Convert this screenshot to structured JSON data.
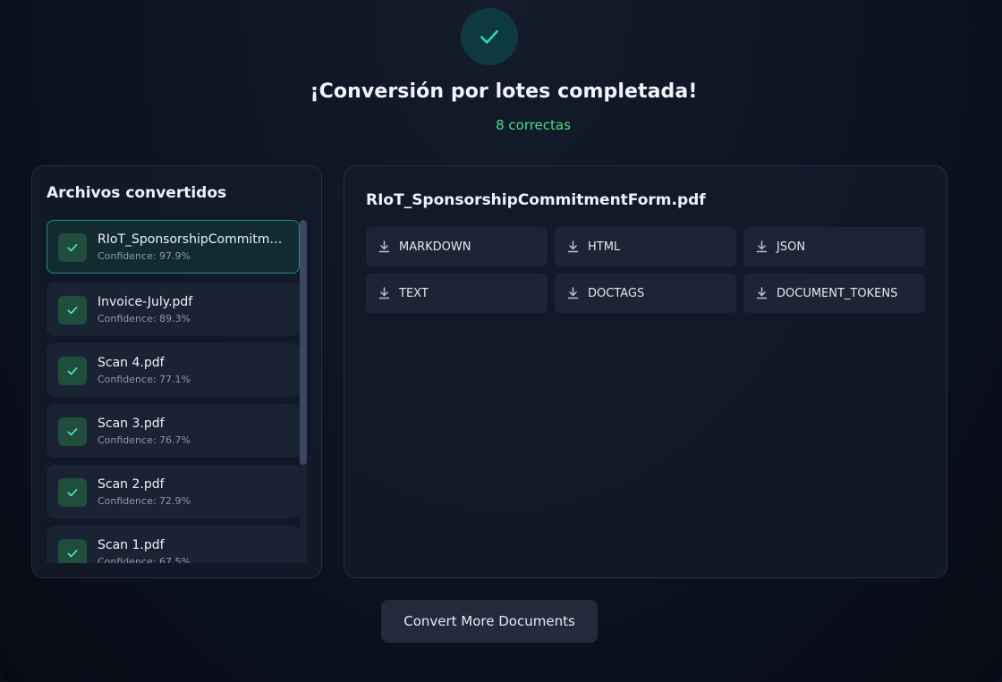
{
  "status": {
    "headline": "¡Conversión por lotes completada!",
    "summary": "8 correctas"
  },
  "files_panel": {
    "title": "Archivos convertidos",
    "selected_index": 0,
    "items": [
      {
        "name": "RIoT_SponsorshipCommitmentForm.pdf",
        "confidence": "Confidence: 97.9%"
      },
      {
        "name": "Invoice-July.pdf",
        "confidence": "Confidence: 89.3%"
      },
      {
        "name": "Scan 4.pdf",
        "confidence": "Confidence: 77.1%"
      },
      {
        "name": "Scan 3.pdf",
        "confidence": "Confidence: 76.7%"
      },
      {
        "name": "Scan 2.pdf",
        "confidence": "Confidence: 72.9%"
      },
      {
        "name": "Scan 1.pdf",
        "confidence": "Confidence: 67.5%"
      }
    ]
  },
  "detail_panel": {
    "title": "RIoT_SponsorshipCommitmentForm.pdf",
    "downloads": [
      "MARKDOWN",
      "HTML",
      "JSON",
      "TEXT",
      "DOCTAGS",
      "DOCUMENT_TOKENS"
    ]
  },
  "actions": {
    "convert_more": "Convert More Documents"
  },
  "icons": {
    "success": "check-icon",
    "file_status": "check-icon",
    "download": "download-icon"
  },
  "colors": {
    "success_green": "#4ade80",
    "accent_teal": "#2dd4bf",
    "selected_border": "#1f8f7a"
  }
}
